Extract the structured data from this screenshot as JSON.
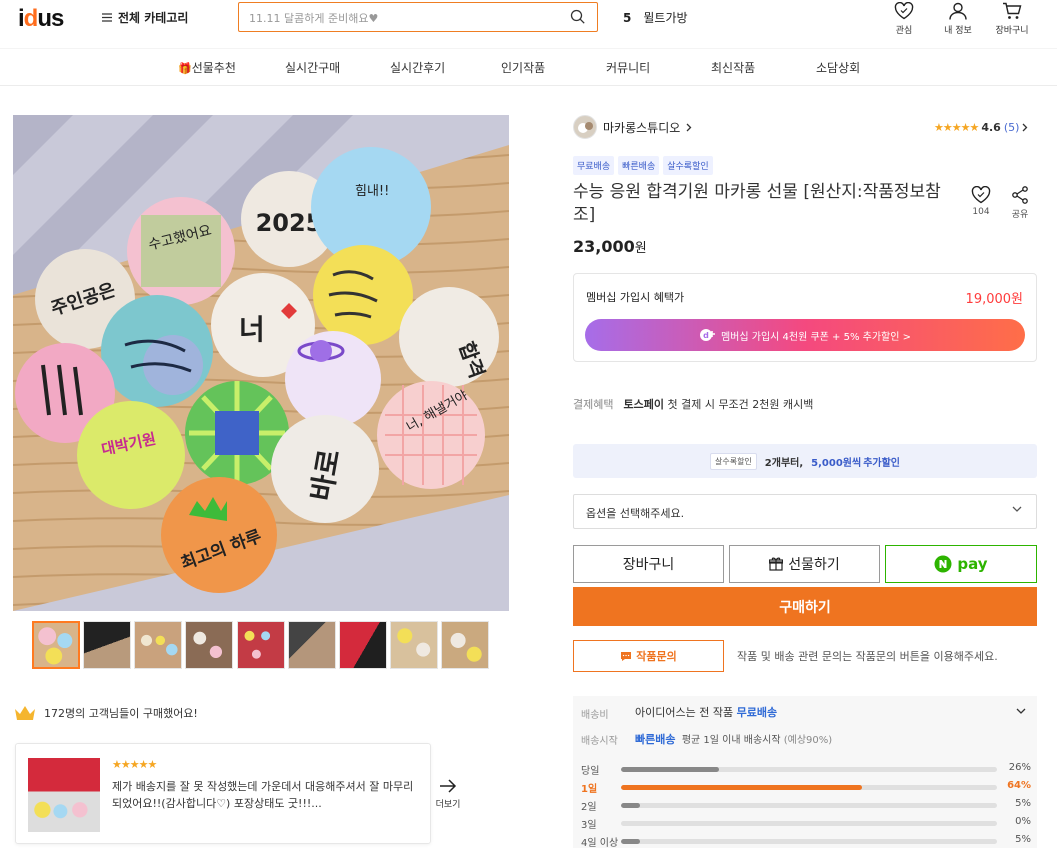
{
  "header": {
    "logo": "idus",
    "all_category": "전체 카테고리",
    "search_placeholder": "11.11 달콤하게 준비해요♥",
    "rank_num": "5",
    "rank_text": "뮐트가방",
    "icons": [
      {
        "name": "heart-icon",
        "label": "관심"
      },
      {
        "name": "user-icon",
        "label": "내 정보"
      },
      {
        "name": "cart-icon",
        "label": "장바구니"
      }
    ]
  },
  "nav": [
    "선물추천",
    "실시간구매",
    "실시간후기",
    "인기작품",
    "커뮤니티",
    "최신작품",
    "소담상회"
  ],
  "product": {
    "artist": "마카롱스튜디오",
    "rating": "4.6",
    "review_count": "(5)",
    "badges": [
      "무료배송",
      "빠른배송",
      "살수록할인"
    ],
    "title": "수능 응원 합격기원 마카롱 선물 [원산지:작품정보참조]",
    "like_count": "104",
    "share_label": "공유",
    "price": "23,000",
    "price_unit": "원"
  },
  "macaron_texts": [
    "2025",
    "수고했어요",
    "주인공은",
    "너",
    "합격",
    "바로",
    "힘내!!",
    "너, 해낼거야",
    "대박기원",
    "최고의 하루"
  ],
  "membership": {
    "label": "멤버십 가입시 혜택가",
    "price": "19,000원",
    "button": "멤버십 가입시  4천원 쿠폰 + 5% 추가할인 >"
  },
  "payment": {
    "key": "결제혜택",
    "brand": "토스페이",
    "text": "첫 결제 시 무조건 2천원 캐시백"
  },
  "coupon": {
    "tag": "살수록할인",
    "text1": "2개부터,",
    "highlight": "5,000원씩",
    "text2": "추가할인"
  },
  "option_placeholder": "옵션을 선택해주세요.",
  "buttons": {
    "cart": "장바구니",
    "gift": "선물하기",
    "npay": "pay",
    "buy": "구매하기",
    "inquiry": "작품문의"
  },
  "inquiry_note": "작품 및 배송 관련 문의는 작품문의 버튼을 이용해주세요.",
  "shipping": {
    "fee_key": "배송비",
    "fee_text": "아이디어스는 전 작품",
    "fee_free": "무료배송",
    "start_key": "배송시작",
    "start_fast": "빠른배송",
    "start_avg": "평균 1일 이내 배송시작",
    "start_pct": "(예상90%)",
    "distribution": [
      {
        "day": "당일",
        "pct": 26,
        "label": "26%"
      },
      {
        "day": "1일",
        "pct": 64,
        "label": "64%"
      },
      {
        "day": "2일",
        "pct": 5,
        "label": "5%"
      },
      {
        "day": "3일",
        "pct": 0,
        "label": "0%"
      },
      {
        "day": "4일 이상",
        "pct": 5,
        "label": "5%"
      }
    ]
  },
  "buyers": "172명의 고객님들이 구매했어요!",
  "review": {
    "stars": "★★★★★",
    "text": "제가 배송지를 잘 못 작성했는데 가운데서 대응해주셔서 잘 마무리 되었어요!!(감사합니다♡) 포장상태도 굿!!!...",
    "more": "더보기"
  },
  "colors": {
    "accent": "#ef7420",
    "blue": "#3a5cc9"
  }
}
